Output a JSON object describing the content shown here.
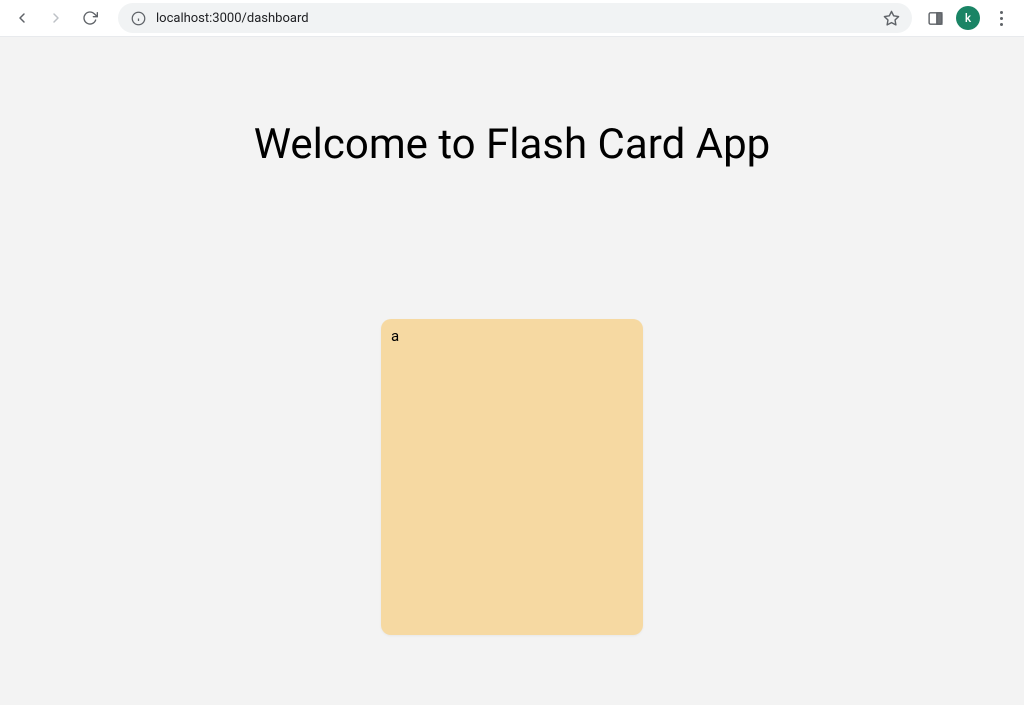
{
  "browser": {
    "url": "localhost:3000/dashboard",
    "avatar_letter": "k"
  },
  "page": {
    "title": "Welcome to Flash Card App"
  },
  "card": {
    "text": "a"
  },
  "colors": {
    "card_bg": "#f6d9a2",
    "page_bg": "#f3f3f3",
    "avatar_bg": "#1a8465"
  }
}
